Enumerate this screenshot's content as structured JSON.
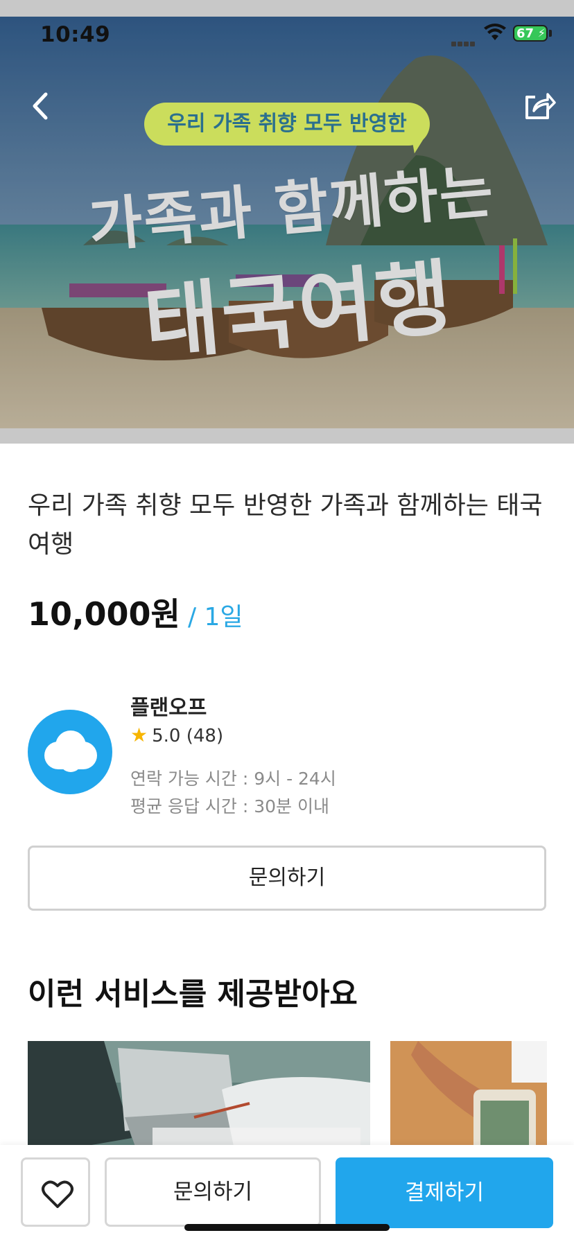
{
  "status_bar": {
    "time": "10:49",
    "battery": "67",
    "icons": [
      "signal-icon",
      "wifi-icon",
      "battery-icon"
    ]
  },
  "nav": {
    "back_icon": "chevron-left-icon",
    "share_icon": "share-icon"
  },
  "hero": {
    "bubble_text": "우리 가족 취향 모두 반영한",
    "line1": "가족과 함께하는",
    "line2": "태국여행"
  },
  "product": {
    "title": "우리 가족 취향 모두 반영한 가족과 함께하는 태국 여행",
    "price": "10,000원",
    "price_unit": "/ 1일"
  },
  "seller": {
    "name": "플랜오프",
    "rating": "5.0",
    "review_count": "(48)",
    "contact_hours": "연락 가능 시간 : 9시 - 24시",
    "response_time": "평균 응답 시간 : 30분 이내"
  },
  "inquiry_button": "문의하기",
  "services": {
    "section_title": "이런 서비스를 제공받아요"
  },
  "bottom_bar": {
    "like_icon": "heart-icon",
    "inquiry_label": "문의하기",
    "pay_label": "결제하기"
  },
  "colors": {
    "accent": "#21a6ec",
    "price_unit": "#2aa8e4",
    "star": "#f7b500",
    "bubble": "#cbdd5c"
  }
}
